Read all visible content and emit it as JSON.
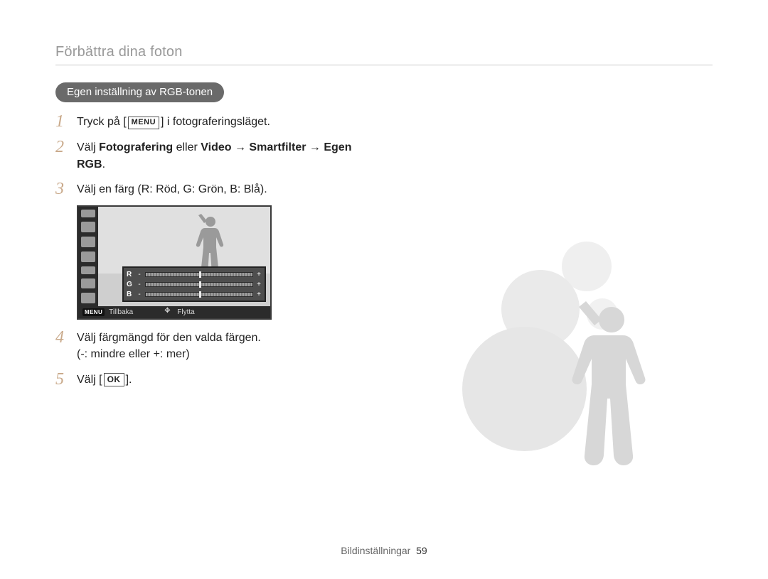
{
  "header": {
    "section_title": "Förbättra dina foton"
  },
  "pill": {
    "label": "Egen inställning av RGB-tonen"
  },
  "keys": {
    "menu": "MENU",
    "ok": "OK"
  },
  "steps": {
    "s1": {
      "num": "1",
      "pre": "Tryck på [",
      "post": "] i fotograferingsläget."
    },
    "s2": {
      "num": "2",
      "pre": "Välj ",
      "bold1": "Fotografering",
      "mid1": " eller ",
      "bold2": "Video",
      "mid2": " → ",
      "bold3": "Smartfilter",
      "mid3": " → ",
      "bold4": "Egen RGB",
      "post": "."
    },
    "s3": {
      "num": "3",
      "text": "Välj en färg (R: Röd, G: Grön, B: Blå)."
    },
    "s4": {
      "num": "4",
      "line1": "Välj färgmängd för den valda färgen.",
      "line2": "(-: mindre eller +: mer)"
    },
    "s5": {
      "num": "5",
      "pre": "Välj [",
      "post": "]."
    }
  },
  "screen": {
    "rgb": {
      "r": "R",
      "g": "G",
      "b": "B",
      "minus": "-",
      "plus": "+"
    },
    "footer": {
      "back_key": "MENU",
      "back_label": "Tillbaka",
      "move_label": "Flytta"
    }
  },
  "footer": {
    "section": "Bildinställningar",
    "page": "59"
  }
}
